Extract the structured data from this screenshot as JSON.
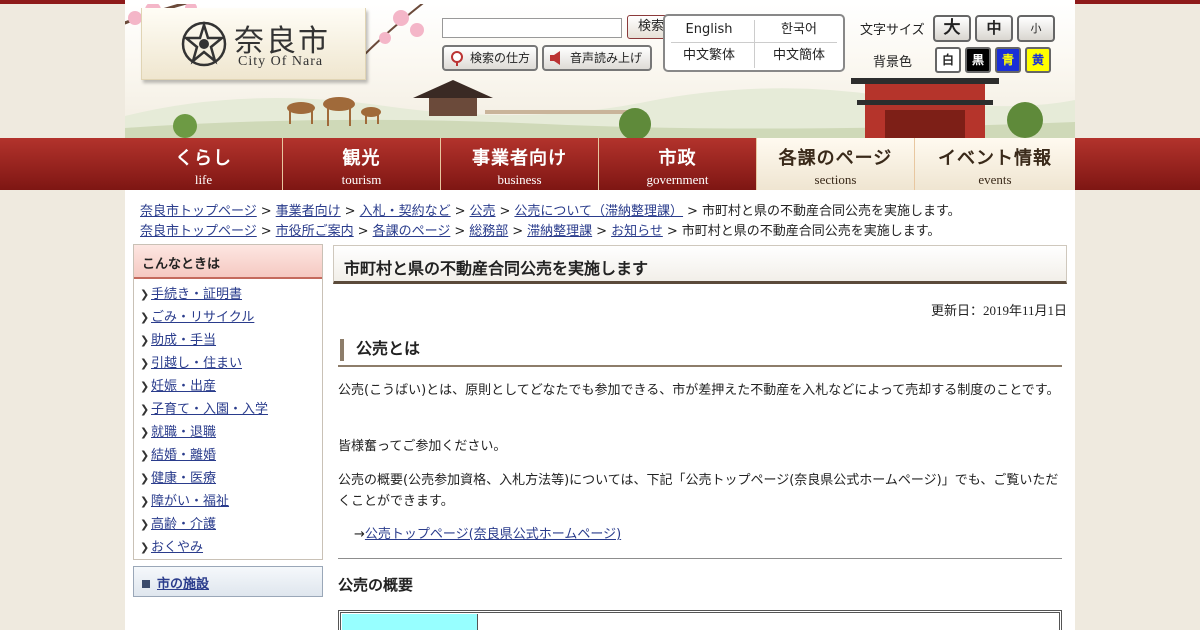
{
  "header": {
    "logo_jp": "奈良市",
    "logo_en": "City Of Nara",
    "search_button": "検索",
    "how_to_search": "検索の仕方",
    "read_aloud": "音声読み上げ",
    "languages": [
      "English",
      "한국어",
      "中文繁体",
      "中文簡体"
    ],
    "font_size_label": "文字サイズ",
    "font_sizes": [
      "大",
      "中",
      "小"
    ],
    "bg_color_label": "背景色",
    "bg_colors": [
      {
        "label": "白",
        "color": "#ffffff",
        "text": "#222222"
      },
      {
        "label": "黒",
        "color": "#000000",
        "text": "#ffffff"
      },
      {
        "label": "青",
        "color": "#1a2fd6",
        "text": "#ffff00"
      },
      {
        "label": "黄",
        "color": "#ffff00",
        "text": "#1a2fd6"
      }
    ]
  },
  "nav": [
    {
      "jp": "くらし",
      "en": "life"
    },
    {
      "jp": "観光",
      "en": "tourism"
    },
    {
      "jp": "事業者向け",
      "en": "business"
    },
    {
      "jp": "市政",
      "en": "government"
    },
    {
      "jp": "各課のページ",
      "en": "sections"
    },
    {
      "jp": "イベント情報",
      "en": "events"
    }
  ],
  "breadcrumbs": [
    {
      "links": [
        "奈良市トップページ",
        "事業者向け",
        "入札・契約など",
        "公売",
        "公売について（滞納整理課）"
      ],
      "current": "市町村と県の不動産合同公売を実施します。"
    },
    {
      "links": [
        "奈良市トップページ",
        "市役所ご案内",
        "各課のページ",
        "総務部",
        "滞納整理課",
        "お知らせ"
      ],
      "current": "市町村と県の不動産合同公売を実施します。"
    }
  ],
  "sidebar": {
    "heading": "こんなときは",
    "items": [
      "手続き・証明書",
      "ごみ・リサイクル",
      "助成・手当",
      "引越し・住まい",
      "妊娠・出産",
      "子育て・入園・入学",
      "就職・退職",
      "結婚・離婚",
      "健康・医療",
      "障がい・福祉",
      "高齢・介護",
      "おくやみ"
    ],
    "facilities": "市の施設"
  },
  "main": {
    "title": "市町村と県の不動産合同公売を実施します",
    "updated": "更新日：2019年11月1日",
    "section_heading": "公売とは",
    "para1": "公売(こうばい)とは、原則としてどなたでも参加できる、市が差押えた不動産を入札などによって売却する制度のことです。",
    "para2": "皆様奮ってご参加ください。",
    "para3": "公売の概要(公売参加資格、入札方法等)については、下記「公売トップページ(奈良県公式ホームページ)」でも、ご覧いただくことができます。",
    "link_arrow": "→",
    "link_text": "公売トップページ(奈良県公式ホームページ)",
    "overview_heading": "公売の概要"
  }
}
